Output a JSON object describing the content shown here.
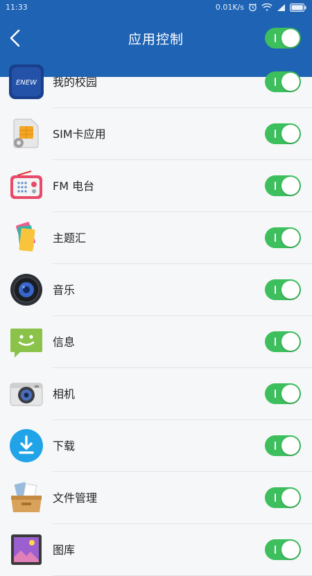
{
  "status_bar": {
    "time": "11:33",
    "speed": "0.01K/s"
  },
  "app_bar": {
    "title": "应用控制"
  },
  "accent": {
    "header_blue": "#1e63b4",
    "switch_green": "#3cbf5c"
  },
  "apps": [
    {
      "label": "我的校园",
      "icon": "enew-logo-icon",
      "icon_text": "ENEW",
      "enabled": true
    },
    {
      "label": "SIM卡应用",
      "icon": "sim-card-icon",
      "enabled": true
    },
    {
      "label": "FM 电台",
      "icon": "radio-icon",
      "enabled": true
    },
    {
      "label": "主题汇",
      "icon": "theme-cards-icon",
      "enabled": true
    },
    {
      "label": "音乐",
      "icon": "speaker-icon",
      "enabled": true
    },
    {
      "label": "信息",
      "icon": "message-smiley-icon",
      "enabled": true
    },
    {
      "label": "相机",
      "icon": "camera-icon",
      "enabled": true
    },
    {
      "label": "下载",
      "icon": "download-icon",
      "enabled": true
    },
    {
      "label": "文件管理",
      "icon": "file-box-icon",
      "enabled": true
    },
    {
      "label": "图库",
      "icon": "gallery-icon",
      "enabled": true
    }
  ]
}
